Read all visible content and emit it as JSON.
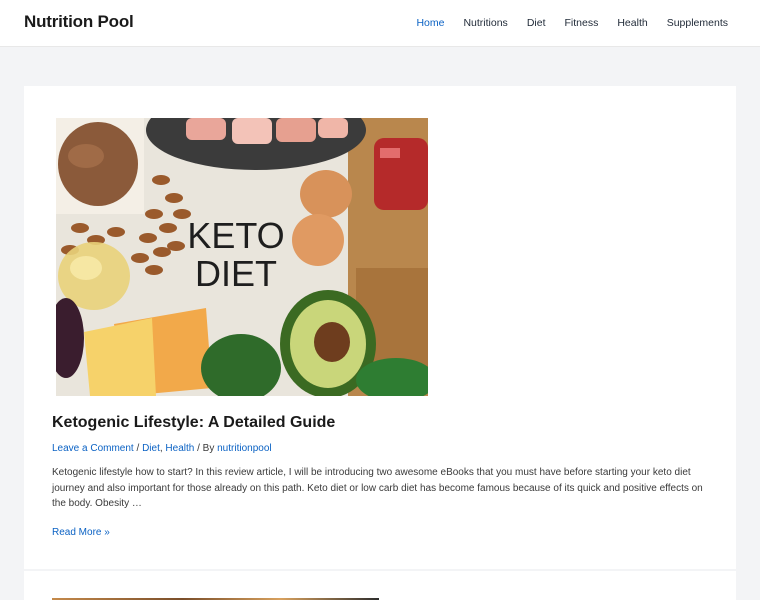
{
  "header": {
    "site_title": "Nutrition Pool",
    "nav": [
      {
        "label": "Home",
        "active": true
      },
      {
        "label": "Nutritions",
        "active": false
      },
      {
        "label": "Diet",
        "active": false
      },
      {
        "label": "Fitness",
        "active": false
      },
      {
        "label": "Health",
        "active": false
      },
      {
        "label": "Supplements",
        "active": false
      }
    ]
  },
  "post": {
    "image_text": [
      "KETO",
      "DIET"
    ],
    "title": "Ketogenic Lifestyle: A Detailed Guide",
    "meta": {
      "comments_link": "Leave a Comment",
      "sep1": " / ",
      "category_1": "Diet",
      "cat_sep": ", ",
      "category_2": "Health",
      "by": " / By ",
      "author": "nutritionpool"
    },
    "excerpt": "Ketogenic lifestyle how to start? In this review article, I will be introducing two awesome eBooks that you must have before starting your keto diet journey and also important for those already on this path. Keto diet or low carb diet has become famous because of its quick and positive effects on the body. Obesity …",
    "read_more": "Read More »"
  },
  "colors": {
    "accent": "#0b62c4",
    "background": "#f3f4f6",
    "card": "#ffffff"
  }
}
